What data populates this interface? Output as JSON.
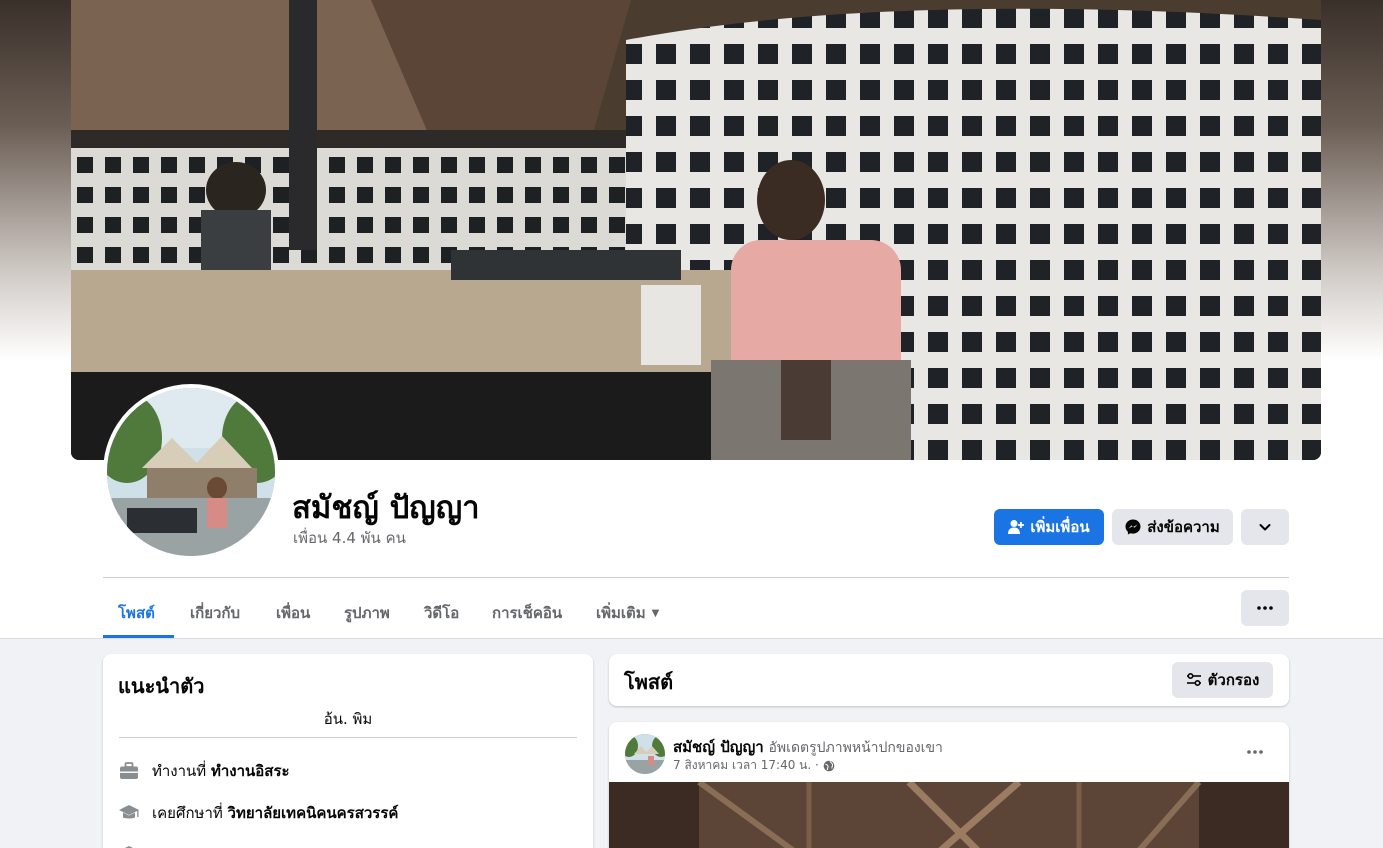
{
  "profile": {
    "name": "สมัชญ์ ปัญญา",
    "friends": "เพื่อน 4.4 พัน คน"
  },
  "actions": {
    "add_friend": "เพิ่มเพื่อน",
    "message": "ส่งข้อความ"
  },
  "tabs": [
    {
      "label": "โพสต์"
    },
    {
      "label": "เกี่ยวกับ"
    },
    {
      "label": "เพื่อน"
    },
    {
      "label": "รูปภาพ"
    },
    {
      "label": "วิดีโอ"
    },
    {
      "label": "การเช็คอิน"
    },
    {
      "label": "เพิ่มเติม"
    }
  ],
  "intro": {
    "title": "แนะนำตัว",
    "bio": "อ้น. พิม",
    "work_prefix": "ทำงานที่",
    "work_value": "ทำงานอิสระ",
    "edu_prefix": "เคยศึกษาที่",
    "edu_value": "วิทยาลัยเทคนิคนครสวรรค์"
  },
  "posts": {
    "title": "โพสต์",
    "filter_label": "ตัวกรอง",
    "item": {
      "author": "สมัชญ์ ปัญญา",
      "action": "อัพเดตรูปภาพหน้าปกของเขา",
      "time": "7 สิงหาคม เวลา 17:40 น. ·"
    }
  },
  "colors": {
    "accent": "#1b74e4",
    "secondary_button": "#e4e6eb",
    "background": "#f0f2f5"
  }
}
